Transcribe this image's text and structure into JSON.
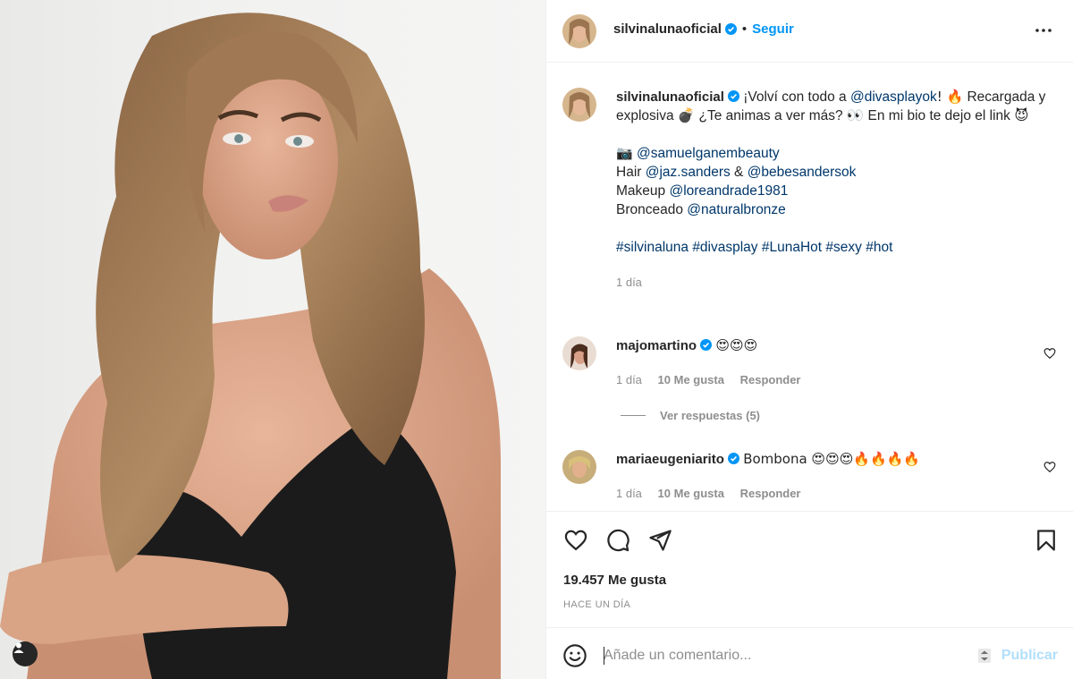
{
  "post": {
    "author": "silvinalunaoficial",
    "follow_label": "Seguir",
    "separator": "•",
    "more_icon": "more-horizontal-icon",
    "caption": {
      "line1_text": "¡Volví con todo a ",
      "line1_mention": "@divasplayok",
      "line1_end": "! 🔥",
      "line2": "Recargada y explosiva 💣 ¿Te animas a ver más? 👀 En mi bio te dejo el link 😈",
      "credit_camera": "📷",
      "credit_photo": "@samuelganembeauty",
      "hair_label": "Hair ",
      "hair_1": "@jaz.sanders",
      "hair_amp": " & ",
      "hair_2": "@bebesandersok",
      "makeup_label": "Makeup ",
      "makeup": "@loreandrade1981",
      "bronze_label": "Bronceado ",
      "bronze": "@naturalbronze",
      "hashtags": [
        "#silvinaluna",
        "#divasplay",
        "#LunaHot",
        "#sexy",
        "#hot"
      ],
      "age": "1 día"
    }
  },
  "comments": [
    {
      "user": "majomartino",
      "text": "😍😍😍",
      "age": "1 día",
      "likes": "10 Me gusta",
      "reply": "Responder"
    },
    {
      "user": "mariaeugeniarito",
      "text": "Bombona 😍😍😍🔥🔥🔥🔥",
      "age": "1 día",
      "likes": "10 Me gusta",
      "reply": "Responder"
    }
  ],
  "view_replies": "Ver respuestas (5)",
  "actions": {
    "like_icon": "heart-icon",
    "comment_icon": "comment-icon",
    "share_icon": "send-icon",
    "save_icon": "bookmark-icon"
  },
  "likes_count": "19.457 Me gusta",
  "timestamp": "HACE UN DÍA",
  "add_comment": {
    "placeholder": "Añade un comentario...",
    "publish": "Publicar"
  },
  "colors": {
    "link": "#00376b",
    "accent": "#0095f6",
    "verified": "#0095f6",
    "muted": "#8e8e8e",
    "publish_disabled": "#b2dffc"
  }
}
